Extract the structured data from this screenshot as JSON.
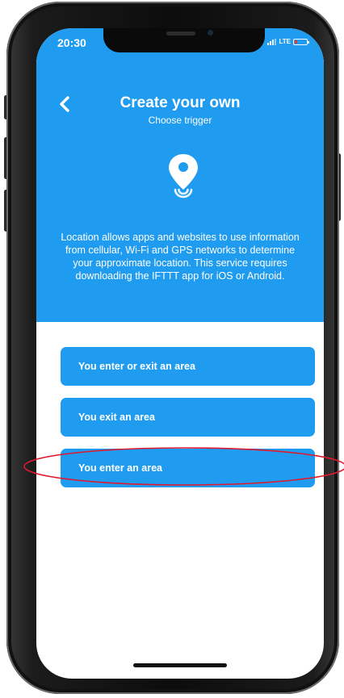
{
  "status_bar": {
    "time": "20:30",
    "carrier": "LTE",
    "battery_color": "#e53935"
  },
  "header": {
    "back_icon": "chevron-left-icon",
    "title": "Create your own",
    "subtitle": "Choose trigger"
  },
  "service": {
    "icon": "location-pin-icon",
    "description": "Location allows apps and websites to use information from cellular, Wi-Fi and GPS networks to determine your approximate location. This service requires downloading the IFTTT app for iOS or Android."
  },
  "triggers": [
    {
      "label": "You enter or exit an area"
    },
    {
      "label": "You exit an area"
    },
    {
      "label": "You enter an area",
      "highlighted": true
    }
  ],
  "colors": {
    "accent": "#1f9bf0",
    "highlight_annotation": "#e0182d",
    "background": "#ffffff"
  }
}
